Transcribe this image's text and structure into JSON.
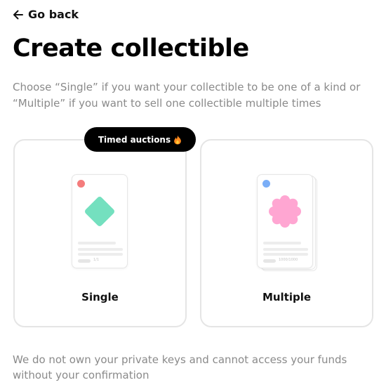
{
  "nav": {
    "back_label": "Go back"
  },
  "header": {
    "title": "Create collectible",
    "subtitle": "Choose “Single” if you want your collectible to be one of a kind or “Multiple” if you want to sell one collectible multiple times"
  },
  "badge": {
    "label": "Timed auctions",
    "icon": "fire-icon"
  },
  "options": {
    "single": {
      "label": "Single",
      "edition": "1/1",
      "dot_color": "#f47c7c",
      "shape_color": "#74e0bf"
    },
    "multiple": {
      "label": "Multiple",
      "edition": "1000/1000",
      "dot_color": "#7aaef7",
      "shape_color": "#ffa6d2"
    }
  },
  "footer": {
    "note": "We do not own your private keys and cannot access your funds without your confirmation"
  },
  "colors": {
    "text_primary": "#000000",
    "text_secondary": "#8a8a8a",
    "card_border": "#e5e5e5",
    "badge_bg": "#000000"
  }
}
